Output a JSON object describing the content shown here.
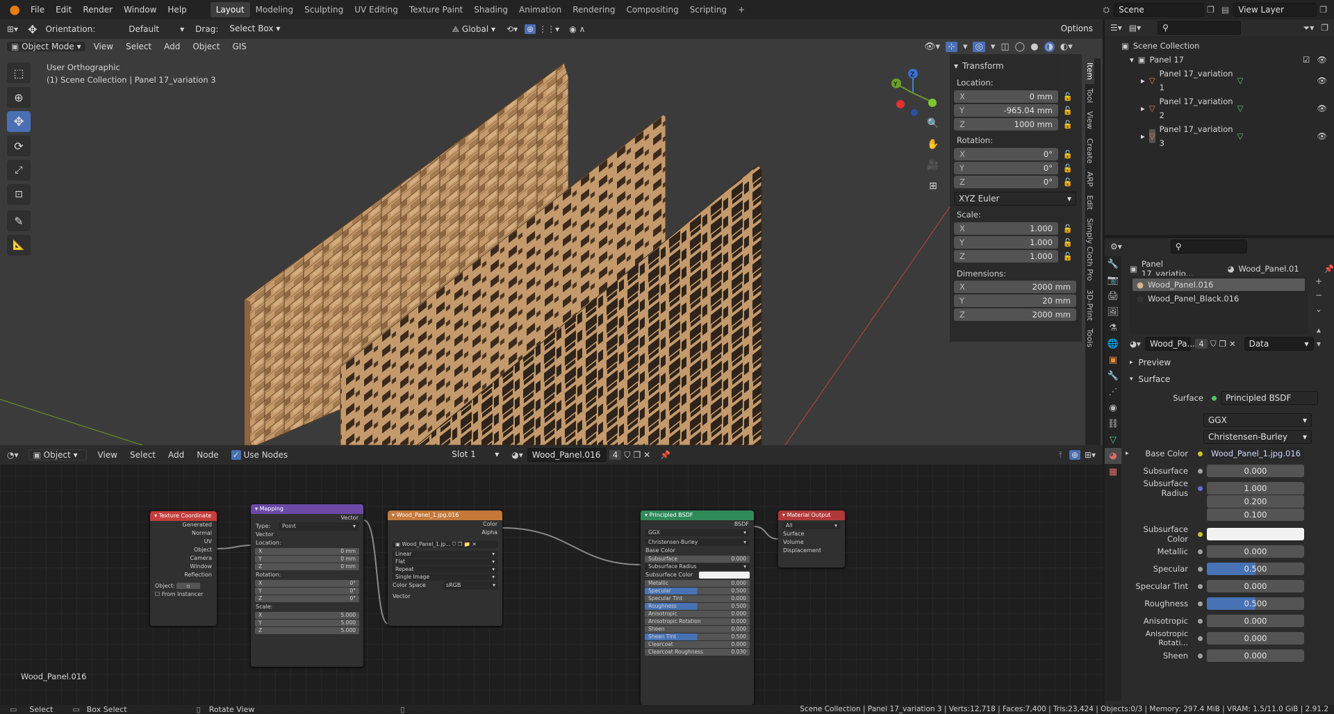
{
  "menubar": {
    "items": [
      "File",
      "Edit",
      "Render",
      "Window",
      "Help"
    ],
    "workspaces": [
      "Layout",
      "Modeling",
      "Sculpting",
      "UV Editing",
      "Texture Paint",
      "Shading",
      "Animation",
      "Rendering",
      "Compositing",
      "Scripting"
    ],
    "active_workspace": "Layout",
    "scene": "Scene",
    "view_layer": "View Layer"
  },
  "viewport_header": {
    "orientation_label": "Orientation:",
    "orientation": "Default",
    "drag_label": "Drag:",
    "drag": "Select Box",
    "transform_space": "Global",
    "options": "Options",
    "mode": "Object Mode",
    "menus": [
      "View",
      "Select",
      "Add",
      "Object",
      "GIS"
    ]
  },
  "viewport": {
    "view_name": "User Orthographic",
    "context": "(1) Scene Collection | Panel 17_variation 3",
    "colors": {
      "wood": "#c49a6c",
      "shadow": "#3a2a1d",
      "bg": "#3b3b3b"
    }
  },
  "npanel": {
    "section": "Transform",
    "location_label": "Location:",
    "location": {
      "x": "0 mm",
      "y": "-965.04 mm",
      "z": "1000 mm"
    },
    "rotation_label": "Rotation:",
    "rotation": {
      "x": "0°",
      "y": "0°",
      "z": "0°"
    },
    "rotation_mode": "XYZ Euler",
    "scale_label": "Scale:",
    "scale": {
      "x": "1.000",
      "y": "1.000",
      "z": "1.000"
    },
    "dimensions_label": "Dimensions:",
    "dimensions": {
      "x": "2000 mm",
      "y": "20 mm",
      "z": "2000 mm"
    },
    "tabs": [
      "Item",
      "Tool",
      "View",
      "Create",
      "ARP",
      "Edit",
      "Simply Cloth Pro",
      "3D-Print",
      "Tools"
    ]
  },
  "outliner": {
    "root": "Scene Collection",
    "collection": "Panel 17",
    "objects": [
      "Panel 17_variation 1",
      "Panel 17_variation 2",
      "Panel 17_variation 3"
    ]
  },
  "properties": {
    "object": "Panel 17_variatio...",
    "material": "Wood_Panel.01",
    "slots": [
      "Wood_Panel.016",
      "Wood_Panel_Black.016"
    ],
    "mat_name": "Wood_Pa...",
    "users": "4",
    "link": "Data",
    "preview": "Preview",
    "surface_section": "Surface",
    "surface_label": "Surface",
    "surface": "Principled BSDF",
    "distribution": "GGX",
    "sss_method": "Christensen-Burley",
    "rows": [
      {
        "label": "Base Color",
        "value": "Wood_Panel_1.jpg.016"
      },
      {
        "label": "Subsurface",
        "value": "0.000"
      },
      {
        "label": "Subsurface Radius",
        "value": "1.000"
      },
      {
        "label": "",
        "value": "0.200"
      },
      {
        "label": "",
        "value": "0.100"
      },
      {
        "label": "Subsurface Color",
        "value": ""
      },
      {
        "label": "Metallic",
        "value": "0.000"
      },
      {
        "label": "Specular",
        "value": "0.500"
      },
      {
        "label": "Specular Tint",
        "value": "0.000"
      },
      {
        "label": "Roughness",
        "value": "0.500"
      },
      {
        "label": "Anisotropic",
        "value": "0.000"
      },
      {
        "label": "Anisotropic Rotati...",
        "value": "0.000"
      },
      {
        "label": "Sheen",
        "value": "0.000"
      }
    ]
  },
  "node_editor": {
    "mode": "Object",
    "menus": [
      "View",
      "Select",
      "Add",
      "Node"
    ],
    "use_nodes": "Use Nodes",
    "slot": "Slot 1",
    "material": "Wood_Panel.016",
    "users": "4",
    "footer": "Wood_Panel.016"
  },
  "nodes": {
    "texcoord": {
      "title": "Texture Coordinate",
      "outputs": [
        "Generated",
        "Normal",
        "UV",
        "Object",
        "Camera",
        "Window",
        "Reflection"
      ],
      "object_label": "Object:",
      "from_instancer": "From Instancer"
    },
    "mapping": {
      "title": "Mapping",
      "vector_out": "Vector",
      "type_label": "Type:",
      "type": "Point",
      "vector_in": "Vector",
      "location": "Location:",
      "loc": [
        "0 mm",
        "0 mm",
        "0 mm"
      ],
      "rotation": "Rotation:",
      "rot": [
        "0°",
        "0°",
        "0°"
      ],
      "scale": "Scale:",
      "scl": [
        "5.000",
        "5.000",
        "5.000"
      ]
    },
    "image": {
      "title": "Wood_Panel_1.jpg.016",
      "outputs": [
        "Color",
        "Alpha"
      ],
      "file": "Wood_Panel_1.jp...",
      "interp": "Linear",
      "proj": "Flat",
      "ext": "Repeat",
      "source": "Single Image",
      "colorspace_label": "Color Space",
      "colorspace": "sRGB",
      "vector": "Vector"
    },
    "bsdf": {
      "title": "Principled BSDF",
      "output": "BSDF",
      "dist": "GGX",
      "sss": "Christensen-Burley",
      "base": "Base Color",
      "rows": [
        [
          "Subsurface",
          "0.000"
        ],
        [
          "Subsurface Radius",
          ""
        ],
        [
          "Subsurface Color",
          ""
        ],
        [
          "Metallic",
          "0.000"
        ],
        [
          "Specular",
          "0.500"
        ],
        [
          "Specular Tint",
          "0.000"
        ],
        [
          "Roughness",
          "0.500"
        ],
        [
          "Anisotropic",
          "0.000"
        ],
        [
          "Anisotropic Rotation",
          "0.000"
        ],
        [
          "Sheen",
          "0.000"
        ],
        [
          "Sheen Tint",
          "0.500"
        ],
        [
          "Clearcoat",
          "0.000"
        ],
        [
          "Clearcoat Roughness",
          "0.030"
        ]
      ]
    },
    "output": {
      "title": "Material Output",
      "target": "All",
      "inputs": [
        "Surface",
        "Volume",
        "Displacement"
      ]
    }
  },
  "statusbar": {
    "select": "Select",
    "box_select": "Box Select",
    "rotate": "Rotate View",
    "info": "Scene Collection | Panel 17_variation 3 | Verts:12,718 | Faces:7,400 | Tris:23,424 | Objects:0/3 | Memory: 297.4 MiB | VRAM: 1.5/11.0 GiB | 2.91.2"
  }
}
